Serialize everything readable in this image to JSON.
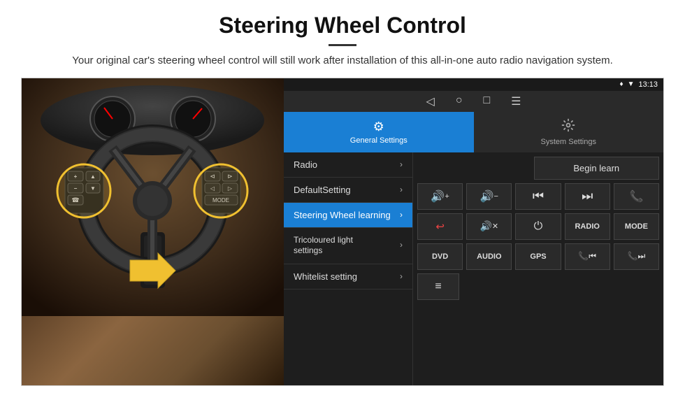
{
  "page": {
    "title": "Steering Wheel Control",
    "divider": "—",
    "subtitle": "Your original car's steering wheel control will still work after installation of this all-in-one auto radio navigation system."
  },
  "status_bar": {
    "time": "13:13",
    "signal_icon": "▼▲",
    "wifi_icon": "♦",
    "location_icon": "♦"
  },
  "nav_bar": {
    "back": "◁",
    "home": "○",
    "recent": "□",
    "menu": "☰"
  },
  "tabs": [
    {
      "id": "general",
      "label": "General Settings",
      "icon": "⚙",
      "active": true
    },
    {
      "id": "system",
      "label": "System Settings",
      "icon": "⚙",
      "active": false
    }
  ],
  "menu_items": [
    {
      "label": "Radio",
      "active": false
    },
    {
      "label": "DefaultSetting",
      "active": false
    },
    {
      "label": "Steering Wheel learning",
      "active": true
    },
    {
      "label": "Tricoloured light settings",
      "active": false
    },
    {
      "label": "Whitelist setting",
      "active": false
    }
  ],
  "controls": {
    "begin_learn": "Begin learn",
    "buttons_row1": [
      "🔊+",
      "🔊−",
      "⏮",
      "⏭",
      "📞"
    ],
    "buttons_row1_symbols": [
      "vol_up",
      "vol_down",
      "prev",
      "next",
      "phone"
    ],
    "buttons_row2": [
      "↩",
      "🔊✕",
      "⏻",
      "RADIO",
      "MODE"
    ],
    "buttons_row3": [
      "DVD",
      "AUDIO",
      "GPS",
      "📞⏮",
      "📞⏭"
    ],
    "row4_icon": "≡"
  }
}
